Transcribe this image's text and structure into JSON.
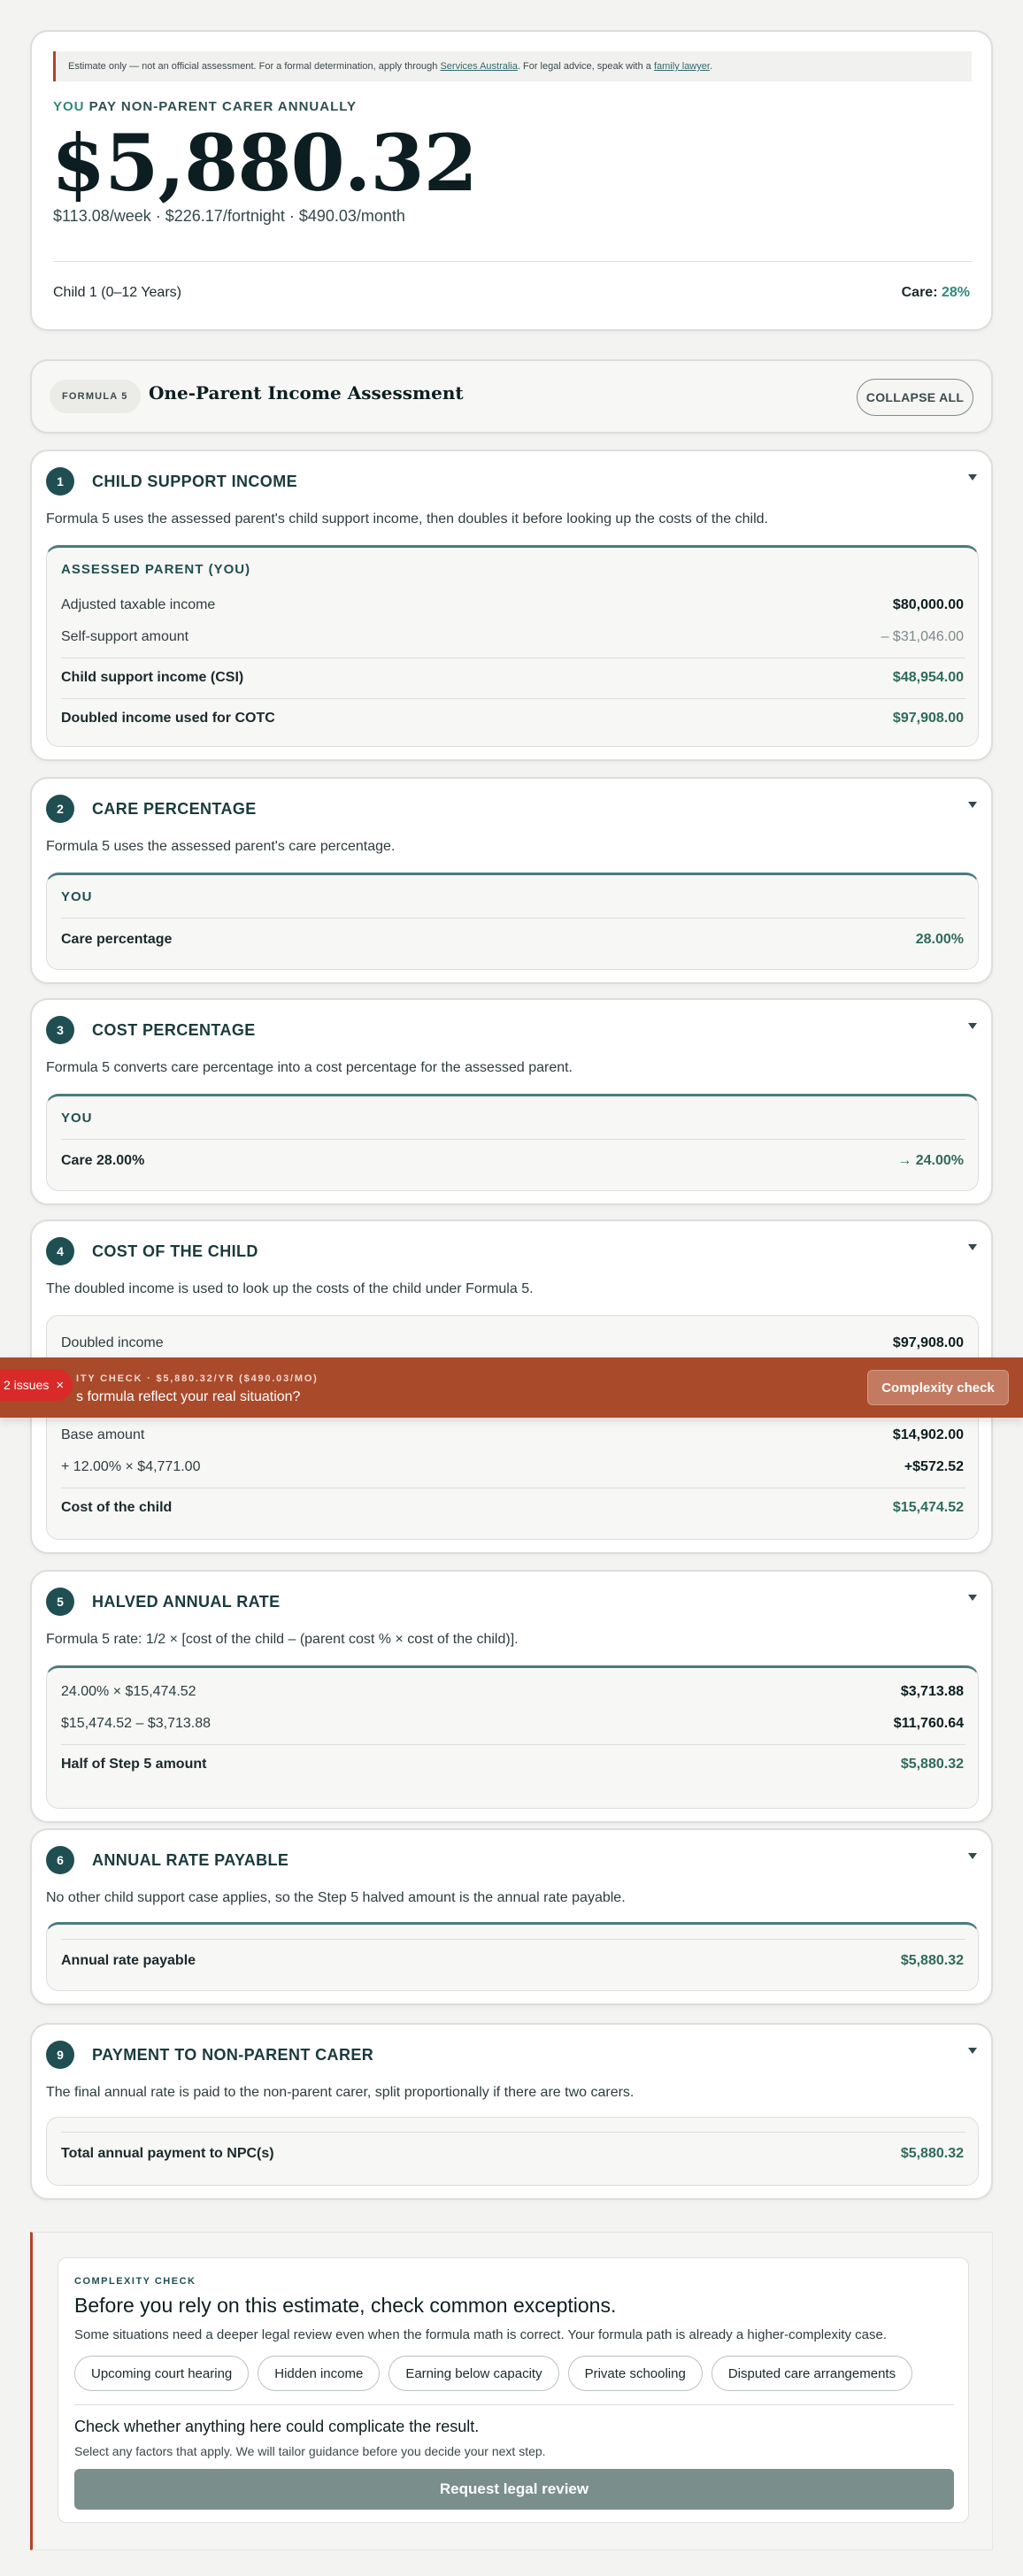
{
  "summary": {
    "disclaimer_lead": "Estimate only — not an official assessment. For a formal determination, apply through ",
    "disclaimer_link1": "Services Australia",
    "disclaimer_mid": ". For legal advice, speak with a ",
    "disclaimer_link2": "family lawyer",
    "disclaimer_end": ".",
    "pay_label_you": "YOU",
    "pay_label_rest": " PAY NON-PARENT CARER ANNUALLY",
    "amount": "$5,880.32",
    "rates": "$113.08/week · $226.17/fortnight · $490.03/month",
    "child_label": "Child 1 (0–12 Years)",
    "care_label": "Care: ",
    "care_pct": "28%"
  },
  "formula": {
    "badge": "FORMULA 5",
    "title": "One-Parent Income Assessment",
    "collapse_label": "COLLAPSE ALL"
  },
  "steps": {
    "s1": {
      "num": "1",
      "title": "CHILD SUPPORT INCOME",
      "desc": "Formula 5 uses the assessed parent's child support income, then doubles it before looking up the costs of the child.",
      "panel_label": "ASSESSED PARENT (YOU)",
      "rows": [
        {
          "label": "Adjusted taxable income",
          "value": "$80,000.00"
        },
        {
          "label": "Self-support amount",
          "value": "– $31,046.00"
        },
        {
          "label": "Child support income (CSI)",
          "value": "$48,954.00"
        },
        {
          "label": "Doubled income used for COTC",
          "value": "$97,908.00"
        }
      ]
    },
    "s2": {
      "num": "2",
      "title": "CARE PERCENTAGE",
      "desc": "Formula 5 uses the assessed parent's care percentage.",
      "panel_label": "YOU",
      "row_label": "Care percentage",
      "row_value": "28.00%"
    },
    "s3": {
      "num": "3",
      "title": "COST PERCENTAGE",
      "desc": "Formula 5 converts care percentage into a cost percentage for the assessed parent.",
      "panel_label": "YOU",
      "row_label": "Care 28.00%",
      "row_value": "→ 24.00%"
    },
    "s4": {
      "num": "4",
      "title": "COST OF THE CHILD",
      "desc": "The doubled income is used to look up the costs of the child under Formula 5.",
      "rows": [
        {
          "label": "Doubled income",
          "value": "$97,908.00"
        },
        {
          "label": "Base amount",
          "value": "$14,902.00"
        },
        {
          "label": "+ 12.00% × $4,771.00",
          "value": "+$572.52"
        },
        {
          "label": "Cost of the child",
          "value": "$15,474.52"
        }
      ]
    },
    "s5": {
      "num": "5",
      "title": "HALVED ANNUAL RATE",
      "desc": "Formula 5 rate: 1/2 × [cost of the child – (parent cost % × cost of the child)].",
      "rows": [
        {
          "label": "24.00% × $15,474.52",
          "value": "$3,713.88"
        },
        {
          "label": "$15,474.52 – $3,713.88",
          "value": "$11,760.64"
        },
        {
          "label": "Half of Step 5 amount",
          "value": "$5,880.32"
        }
      ]
    },
    "s6": {
      "num": "6",
      "title": "ANNUAL RATE PAYABLE",
      "desc": "No other child support case applies, so the Step 5 halved amount is the annual rate payable.",
      "row_label": "Annual rate payable",
      "row_value": "$5,880.32"
    },
    "s9": {
      "num": "9",
      "title": "PAYMENT TO NON-PARENT CARER",
      "desc": "The final annual rate is paid to the non-parent carer, split proportionally if there are two carers.",
      "row_label": "Total annual payment to NPC(s)",
      "row_value": "$5,880.32"
    }
  },
  "sticky": {
    "issues_label": "2 issues",
    "close_glyph": "×",
    "kicker": "ITY CHECK · $5,880.32/YR ($490.03/MO)",
    "question": "s formula reflect your real situation?",
    "button_label": "Complexity check"
  },
  "complexity": {
    "kicker": "COMPLEXITY CHECK",
    "heading": "Before you rely on this estimate, check common exceptions.",
    "sub": "Some situations need a deeper legal review even when the formula math is correct. Your formula path is already a higher-complexity case.",
    "chips": [
      "Upcoming court hearing",
      "Hidden income",
      "Earning below capacity",
      "Private schooling",
      "Disputed care arrangements"
    ],
    "question": "Check whether anything here could complicate the result.",
    "hint": "Select any factors that apply. We will tailor guidance before you decide your next step.",
    "button_label": "Request legal review"
  }
}
